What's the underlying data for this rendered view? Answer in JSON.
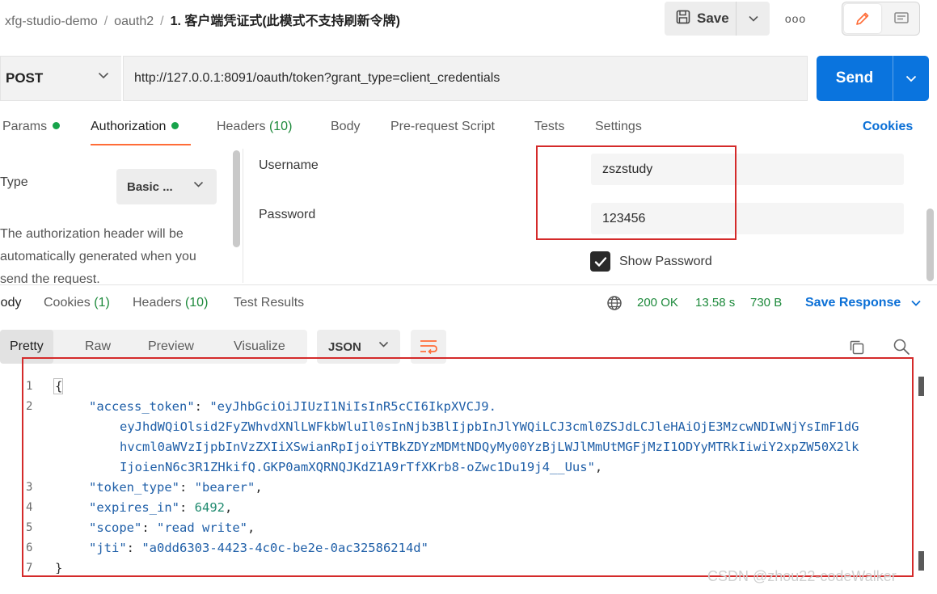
{
  "breadcrumb": {
    "workspace": "xfg-studio-demo",
    "collection": "oauth2",
    "request": "1. 客户端凭证式(此模式不支持刷新令牌)",
    "separator": "/"
  },
  "toolbar": {
    "save_label": "Save",
    "more_label": "ooo"
  },
  "request": {
    "method": "POST",
    "url": "http://127.0.0.1:8091/oauth/token?grant_type=client_credentials",
    "send_label": "Send"
  },
  "request_tabs": {
    "params": "Params",
    "authorization": "Authorization",
    "headers": "Headers",
    "headers_count": "(10)",
    "body": "Body",
    "pre_request": "Pre-request Script",
    "tests": "Tests",
    "settings": "Settings",
    "cookies": "Cookies"
  },
  "auth": {
    "type_label": "Type",
    "type_value": "Basic ...",
    "help_text": "The authorization header will be automatically generated when you send the request.",
    "username_label": "Username",
    "username_value": "zszstudy",
    "password_label": "Password",
    "password_value": "123456",
    "show_password_label": "Show Password",
    "show_password_checked": true
  },
  "response_tabs": {
    "body": "Body",
    "cookies": "Cookies",
    "cookies_count": "(1)",
    "headers": "Headers",
    "headers_count": "(10)",
    "test_results": "Test Results"
  },
  "response_status": {
    "status": "200 OK",
    "time": "13.58 s",
    "size": "730 B",
    "save_response": "Save Response"
  },
  "view": {
    "pretty": "Pretty",
    "raw": "Raw",
    "preview": "Preview",
    "visualize": "Visualize",
    "format": "JSON"
  },
  "code": {
    "line_numbers": [
      "1",
      "2",
      "3",
      "4",
      "5",
      "6",
      "7"
    ],
    "open_brace": "{",
    "close_brace": "}",
    "access_token_key": "\"access_token\"",
    "access_token_lines": [
      "\"eyJhbGciOiJIUzI1NiIsInR5cCI6IkpXVCJ9.",
      "eyJhdWQiOlsid2FyZWhvdXNlLWFkbWluIl0sInNjb3BlIjpbInJlYWQiLCJ3cml0ZSJdLCJleHAiOjE3MzcwNDIwNjYsImF1dG",
      "hvcml0aWVzIjpbInVzZXIiXSwianRpIjoiYTBkZDYzMDMtNDQyMy00YzBjLWJlMmUtMGFjMzI1ODYyMTRkIiwiY2xpZW50X2lk",
      "IjoienN6c3R1ZHkifQ.GKP0amXQRNQJKdZ1A9rTfXKrb8-oZwc1Du19j4__Uus\""
    ],
    "token_type_key": "\"token_type\"",
    "token_type_value": "\"bearer\"",
    "expires_in_key": "\"expires_in\"",
    "expires_in_value": "6492",
    "scope_key": "\"scope\"",
    "scope_value": "\"read write\"",
    "jti_key": "\"jti\"",
    "jti_value": "\"a0dd6303-4423-4c0c-be2e-0ac32586214d\""
  },
  "watermark": "CSDN @zhou22-codeWalker",
  "colors": {
    "accent_orange": "#ff6c37",
    "send_blue": "#0a74de",
    "link_blue": "#0a6fd6",
    "status_green": "#1e8a3c",
    "highlight_red": "#d42a2a"
  }
}
